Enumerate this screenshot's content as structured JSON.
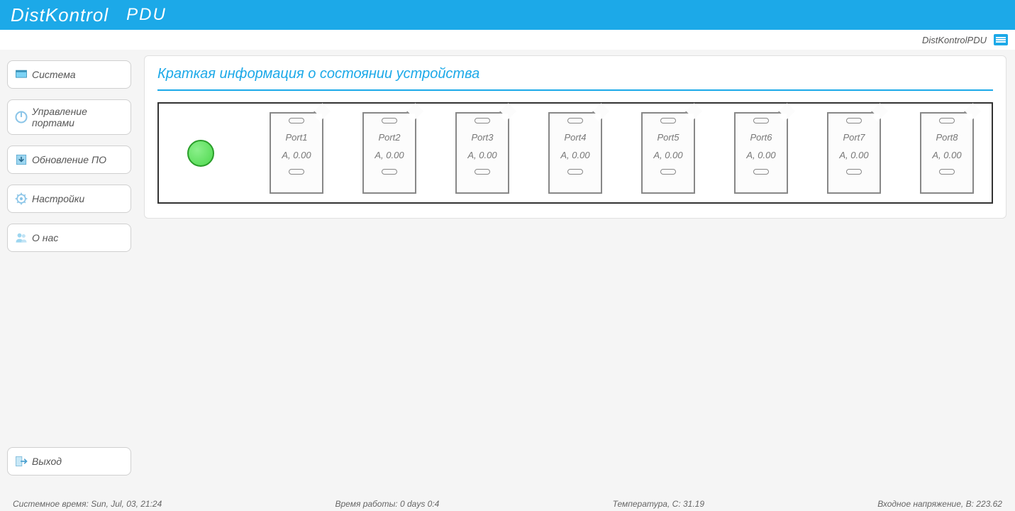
{
  "header": {
    "brand": "DistKontrol",
    "product": "PDU"
  },
  "subheader": {
    "label": "DistKontrolPDU"
  },
  "sidebar": {
    "items": [
      {
        "label": "Система",
        "icon": "system"
      },
      {
        "label": "Управление портами",
        "icon": "power"
      },
      {
        "label": "Обновление ПО",
        "icon": "download"
      },
      {
        "label": "Настройки",
        "icon": "gear"
      },
      {
        "label": "О нас",
        "icon": "users"
      }
    ],
    "logout": {
      "label": "Выход",
      "icon": "exit"
    }
  },
  "main": {
    "panel_title": "Краткая информация о состоянии устройства",
    "status": "ok",
    "ports": [
      {
        "name": "Port1",
        "value": "A, 0.00"
      },
      {
        "name": "Port2",
        "value": "A, 0.00"
      },
      {
        "name": "Port3",
        "value": "A, 0.00"
      },
      {
        "name": "Port4",
        "value": "A, 0.00"
      },
      {
        "name": "Port5",
        "value": "A, 0.00"
      },
      {
        "name": "Port6",
        "value": "A, 0.00"
      },
      {
        "name": "Port7",
        "value": "A, 0.00"
      },
      {
        "name": "Port8",
        "value": "A, 0.00"
      }
    ]
  },
  "footer": {
    "system_time_label": "Системное время:",
    "system_time_value": "Sun, Jul, 03, 21:24",
    "uptime_label": "Время работы:",
    "uptime_value": "0 days 0:4",
    "temperature_label": "Температура, С:",
    "temperature_value": "31.19",
    "voltage_label": "Входное напряжение, В:",
    "voltage_value": "223.62"
  }
}
